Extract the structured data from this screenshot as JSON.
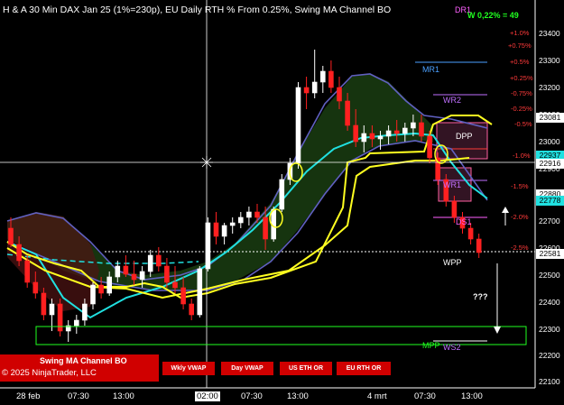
{
  "title": "H & A 30 Min DAX Jan 25  (1%=230p), EU Daily RTH % From 0.25%, Swing MA Channel BO",
  "top_right_label": "DR1",
  "top_right_stat": "W 0,22% = 49",
  "colors": {
    "up_candle": "#ffffff",
    "down_candle": "#ff2020",
    "fast_ma": "#20e0e0",
    "slow_ma": "#6060c0",
    "channel": "#ffff20",
    "accent": "#d00000"
  },
  "panel": {
    "line1": "Swing MA Channel BO",
    "line2": "© 2025 NinjaTrader, LLC"
  },
  "buttons": {
    "wkly_vwap": "Wkly VWAP",
    "day_vwap": "Day VWAP",
    "us_eth_or": "US ETH OR",
    "eu_rth_or": "EU RTH OR"
  },
  "x_axis": {
    "labels": [
      "28 feb",
      "07:30",
      "13:00",
      "02:00",
      "07:30",
      "13:00",
      "4 mrt",
      "07:30",
      "13:00"
    ]
  },
  "y_axis": {
    "labels": [
      "23400",
      "23300",
      "23200",
      "23100",
      "23000",
      "22900",
      "22800",
      "22700",
      "22600",
      "22500",
      "22400",
      "22300",
      "22200",
      "22100"
    ]
  },
  "price_tags": {
    "t1": "23081",
    "t2": "22937",
    "t3": "22916",
    "t4": "22880",
    "t5": "22778",
    "t6": "22581"
  },
  "pct_levels": {
    "p1": "+1.0%",
    "p2": "+0.75%",
    "p3": "+0.5%",
    "p4": "+0.25%",
    "p5": "-0.75%",
    "p6": "-0.25%",
    "p7": "-0.5%",
    "p8": "-1.0%",
    "p9": "-1.5%",
    "p10": "-2.0%",
    "p11": "-2.5%"
  },
  "levels": {
    "mr1": "MR1",
    "wr2": "WR2",
    "dpp": "DPP",
    "wr1": "WR1",
    "ds1": "DS1",
    "wpp": "WPP",
    "mpp": "MPP",
    "ws2": "WS2",
    "question": "???"
  },
  "chart_data": {
    "type": "candlestick",
    "title": "H & A 30 Min DAX Jan 25  (1%=230p), EU Daily RTH % From 0.25%, Swing MA Channel BO",
    "ylim": [
      22100,
      23450
    ],
    "candles": [
      [
        22680,
        22720,
        22610,
        22620
      ],
      [
        22620,
        22650,
        22540,
        22560
      ],
      [
        22560,
        22580,
        22460,
        22480
      ],
      [
        22480,
        22520,
        22420,
        22440
      ],
      [
        22440,
        22460,
        22340,
        22360
      ],
      [
        22360,
        22420,
        22300,
        22400
      ],
      [
        22400,
        22420,
        22280,
        22300
      ],
      [
        22300,
        22340,
        22260,
        22320
      ],
      [
        22320,
        22360,
        22290,
        22340
      ],
      [
        22340,
        22420,
        22320,
        22400
      ],
      [
        22400,
        22480,
        22380,
        22470
      ],
      [
        22470,
        22500,
        22420,
        22440
      ],
      [
        22440,
        22520,
        22430,
        22500
      ],
      [
        22500,
        22560,
        22480,
        22540
      ],
      [
        22540,
        22580,
        22500,
        22510
      ],
      [
        22510,
        22560,
        22470,
        22490
      ],
      [
        22490,
        22540,
        22460,
        22520
      ],
      [
        22520,
        22600,
        22500,
        22580
      ],
      [
        22580,
        22610,
        22520,
        22540
      ],
      [
        22540,
        22570,
        22460,
        22480
      ],
      [
        22480,
        22540,
        22440,
        22460
      ],
      [
        22460,
        22500,
        22380,
        22400
      ],
      [
        22400,
        22420,
        22340,
        22360
      ],
      [
        22360,
        22540,
        22350,
        22530
      ],
      [
        22530,
        22720,
        22520,
        22700
      ],
      [
        22700,
        22740,
        22620,
        22650
      ],
      [
        22650,
        22700,
        22620,
        22690
      ],
      [
        22690,
        22720,
        22660,
        22700
      ],
      [
        22700,
        22740,
        22680,
        22720
      ],
      [
        22720,
        22760,
        22690,
        22740
      ],
      [
        22740,
        22770,
        22700,
        22720
      ],
      [
        22720,
        22760,
        22600,
        22640
      ],
      [
        22640,
        22760,
        22630,
        22750
      ],
      [
        22750,
        22880,
        22740,
        22860
      ],
      [
        22860,
        22940,
        22840,
        22920
      ],
      [
        22920,
        23220,
        22900,
        23200
      ],
      [
        23200,
        23240,
        23120,
        23180
      ],
      [
        23180,
        23340,
        23160,
        23220
      ],
      [
        23220,
        23280,
        23180,
        23260
      ],
      [
        23260,
        23300,
        23180,
        23200
      ],
      [
        23200,
        23240,
        23120,
        23150
      ],
      [
        23150,
        23180,
        23040,
        23060
      ],
      [
        23060,
        23120,
        22980,
        23000
      ],
      [
        23000,
        23060,
        22960,
        23030
      ],
      [
        23030,
        23060,
        22980,
        23010
      ],
      [
        23010,
        23040,
        22970,
        23020
      ],
      [
        23020,
        23060,
        22990,
        23040
      ],
      [
        23040,
        23080,
        23000,
        23030
      ],
      [
        23030,
        23070,
        23000,
        23050
      ],
      [
        23050,
        23100,
        23020,
        23070
      ],
      [
        23070,
        23100,
        23000,
        23020
      ],
      [
        23020,
        23040,
        22920,
        22940
      ],
      [
        22940,
        22960,
        22840,
        22860
      ],
      [
        22860,
        22880,
        22760,
        22780
      ],
      [
        22780,
        22800,
        22700,
        22720
      ],
      [
        22720,
        22740,
        22660,
        22680
      ],
      [
        22680,
        22700,
        22620,
        22640
      ],
      [
        22640,
        22660,
        22570,
        22590
      ]
    ]
  }
}
